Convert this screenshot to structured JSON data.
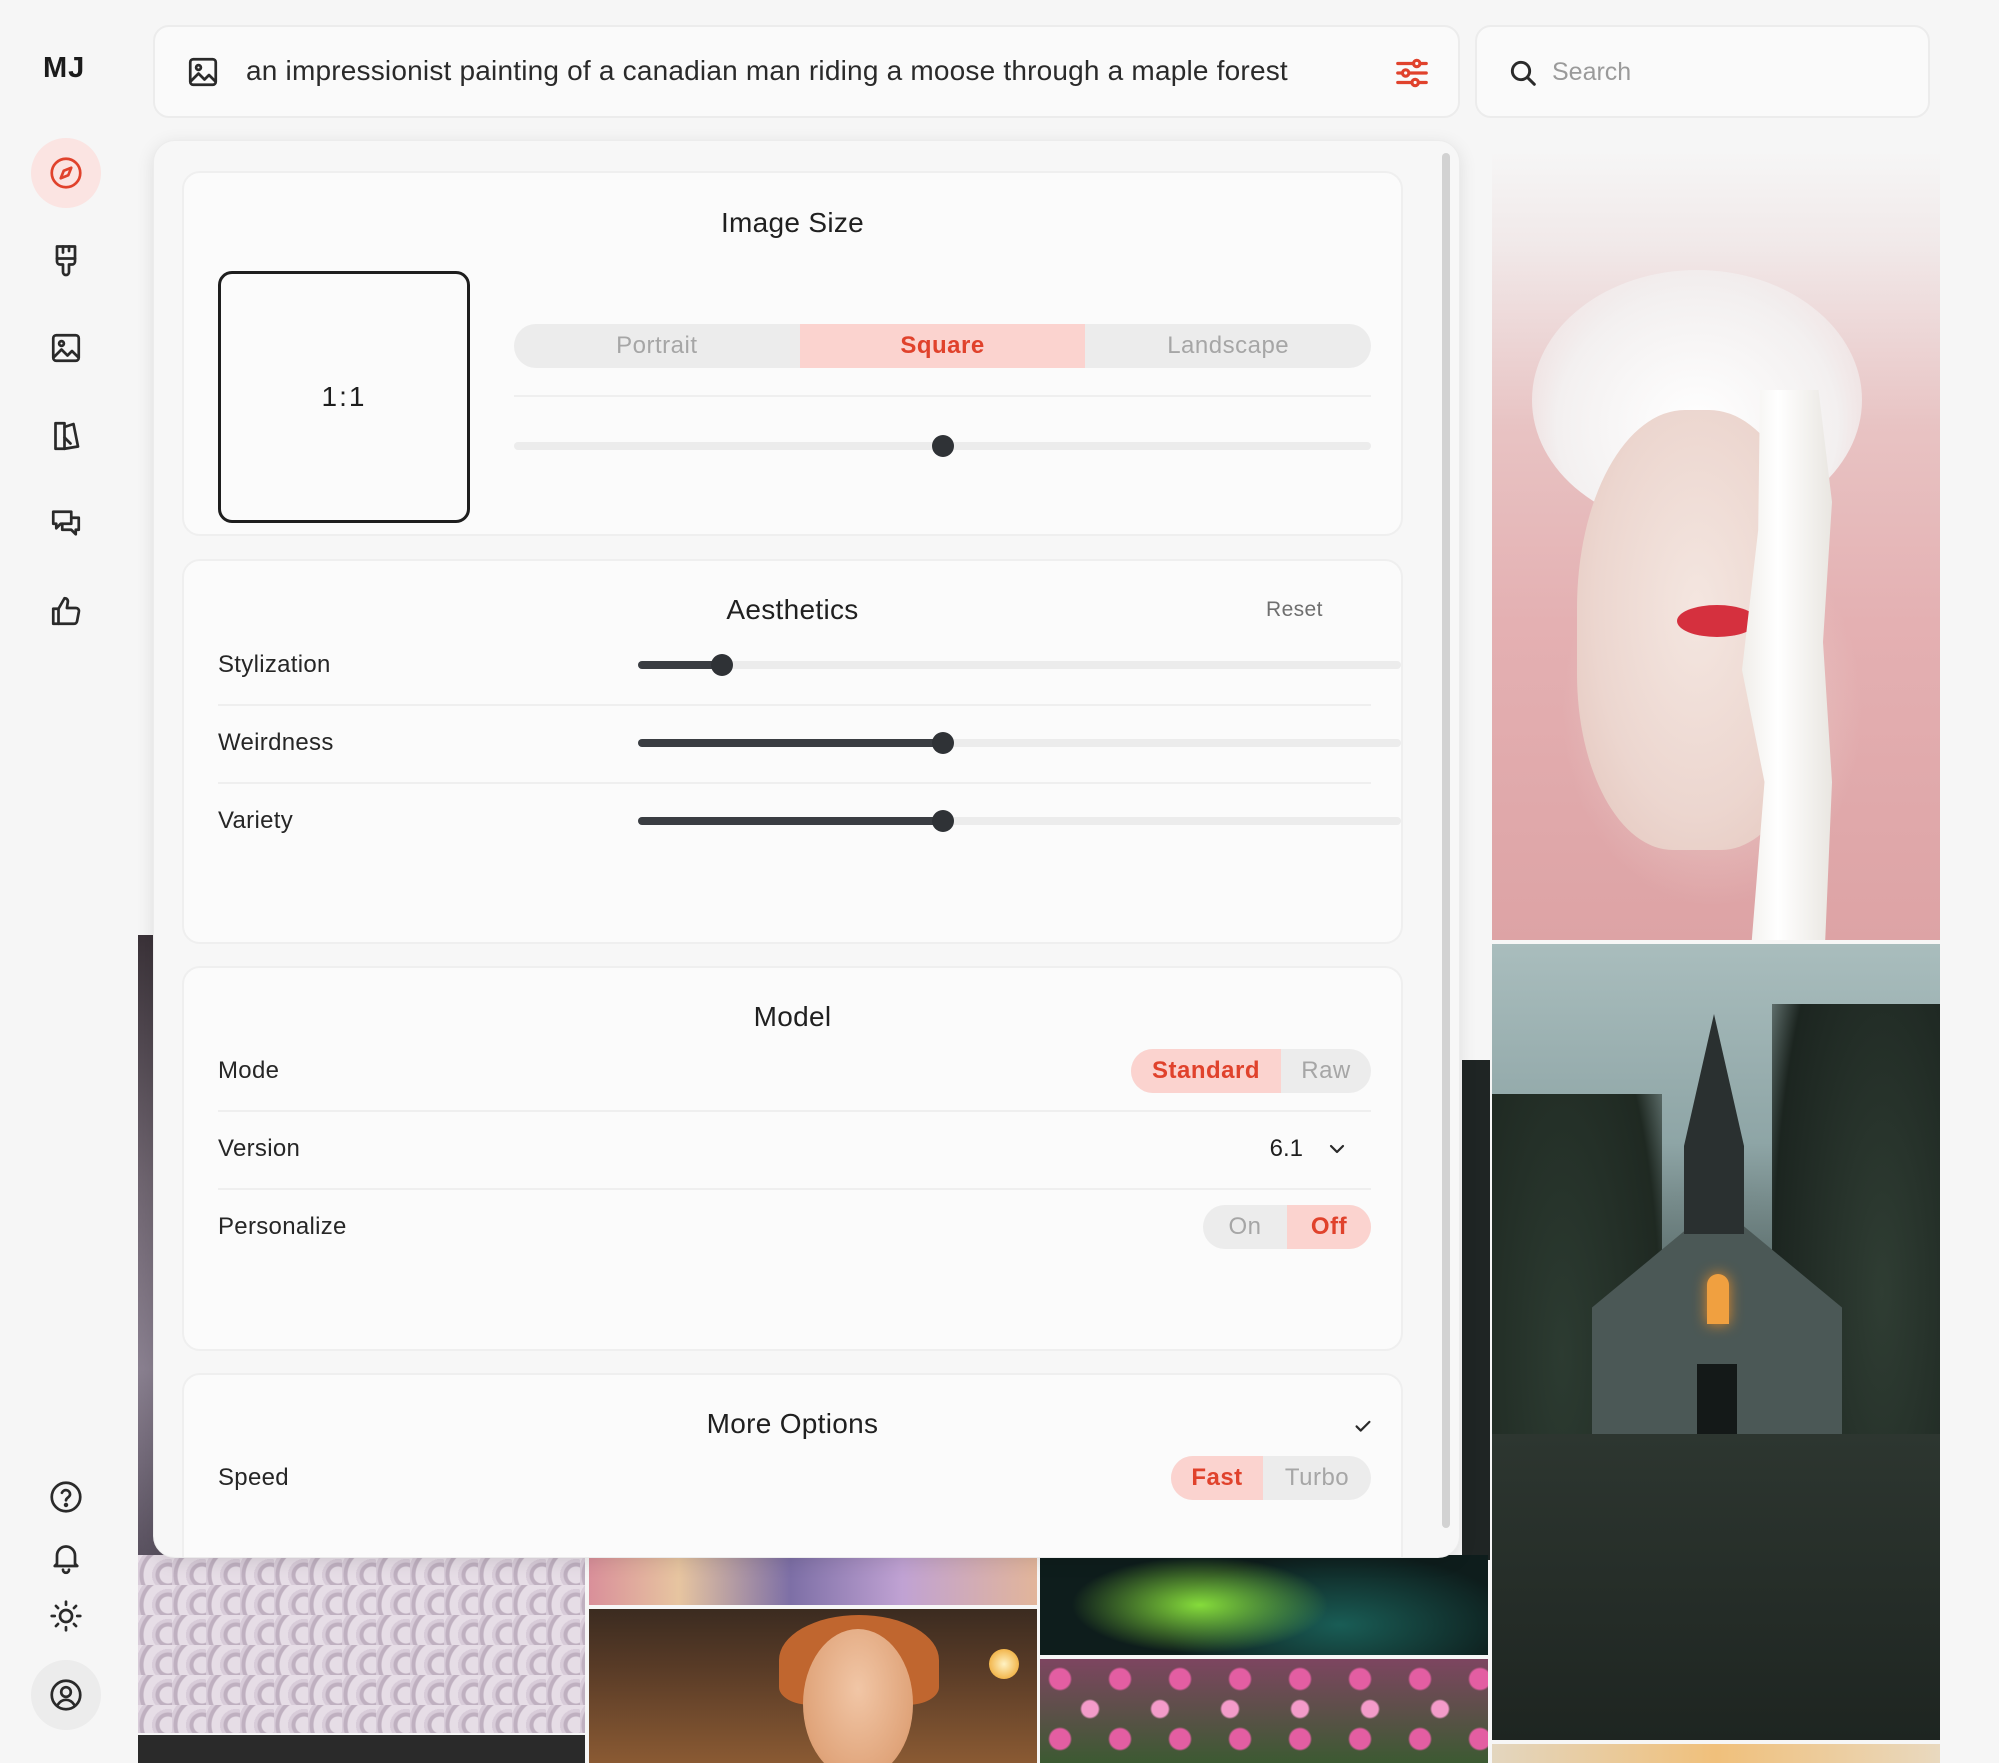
{
  "app": {
    "logo": "MJ"
  },
  "sidebar": {
    "items": [
      {
        "icon": "compass-icon",
        "active": true
      },
      {
        "icon": "paintbrush-icon",
        "active": false
      },
      {
        "icon": "image-icon",
        "active": false
      },
      {
        "icon": "book-icon",
        "active": false
      },
      {
        "icon": "chat-icon",
        "active": false
      },
      {
        "icon": "thumbs-up-icon",
        "active": false
      }
    ],
    "bottom": [
      {
        "icon": "help-icon"
      },
      {
        "icon": "bell-icon"
      },
      {
        "icon": "sun-icon"
      },
      {
        "icon": "account-icon"
      }
    ]
  },
  "prompt": {
    "text": "an impressionist painting of a canadian man riding a moose through a maple forest"
  },
  "search": {
    "placeholder": "Search",
    "value": ""
  },
  "settings": {
    "image_size": {
      "title": "Image Size",
      "ratio": "1:1",
      "orientations": [
        "Portrait",
        "Square",
        "Landscape"
      ],
      "selected": "Square",
      "slider_value": 0.5
    },
    "aesthetics": {
      "title": "Aesthetics",
      "reset_label": "Reset",
      "sliders": [
        {
          "label": "Stylization",
          "value": 0.11
        },
        {
          "label": "Weirdness",
          "value": 0.4
        },
        {
          "label": "Variety",
          "value": 0.4
        }
      ]
    },
    "model": {
      "title": "Model",
      "mode": {
        "label": "Mode",
        "options": [
          "Standard",
          "Raw"
        ],
        "selected": "Standard"
      },
      "version": {
        "label": "Version",
        "value": "6.1"
      },
      "personalize": {
        "label": "Personalize",
        "options": [
          "On",
          "Off"
        ],
        "selected": "Off"
      }
    },
    "more_options": {
      "title": "More Options",
      "speed": {
        "label": "Speed",
        "options": [
          "Fast",
          "Turbo"
        ],
        "selected": "Fast"
      }
    }
  },
  "colors": {
    "accent": "#e0422c",
    "accent_bg": "#fbd3cf",
    "active_nav_bg": "#fbe4e2"
  }
}
